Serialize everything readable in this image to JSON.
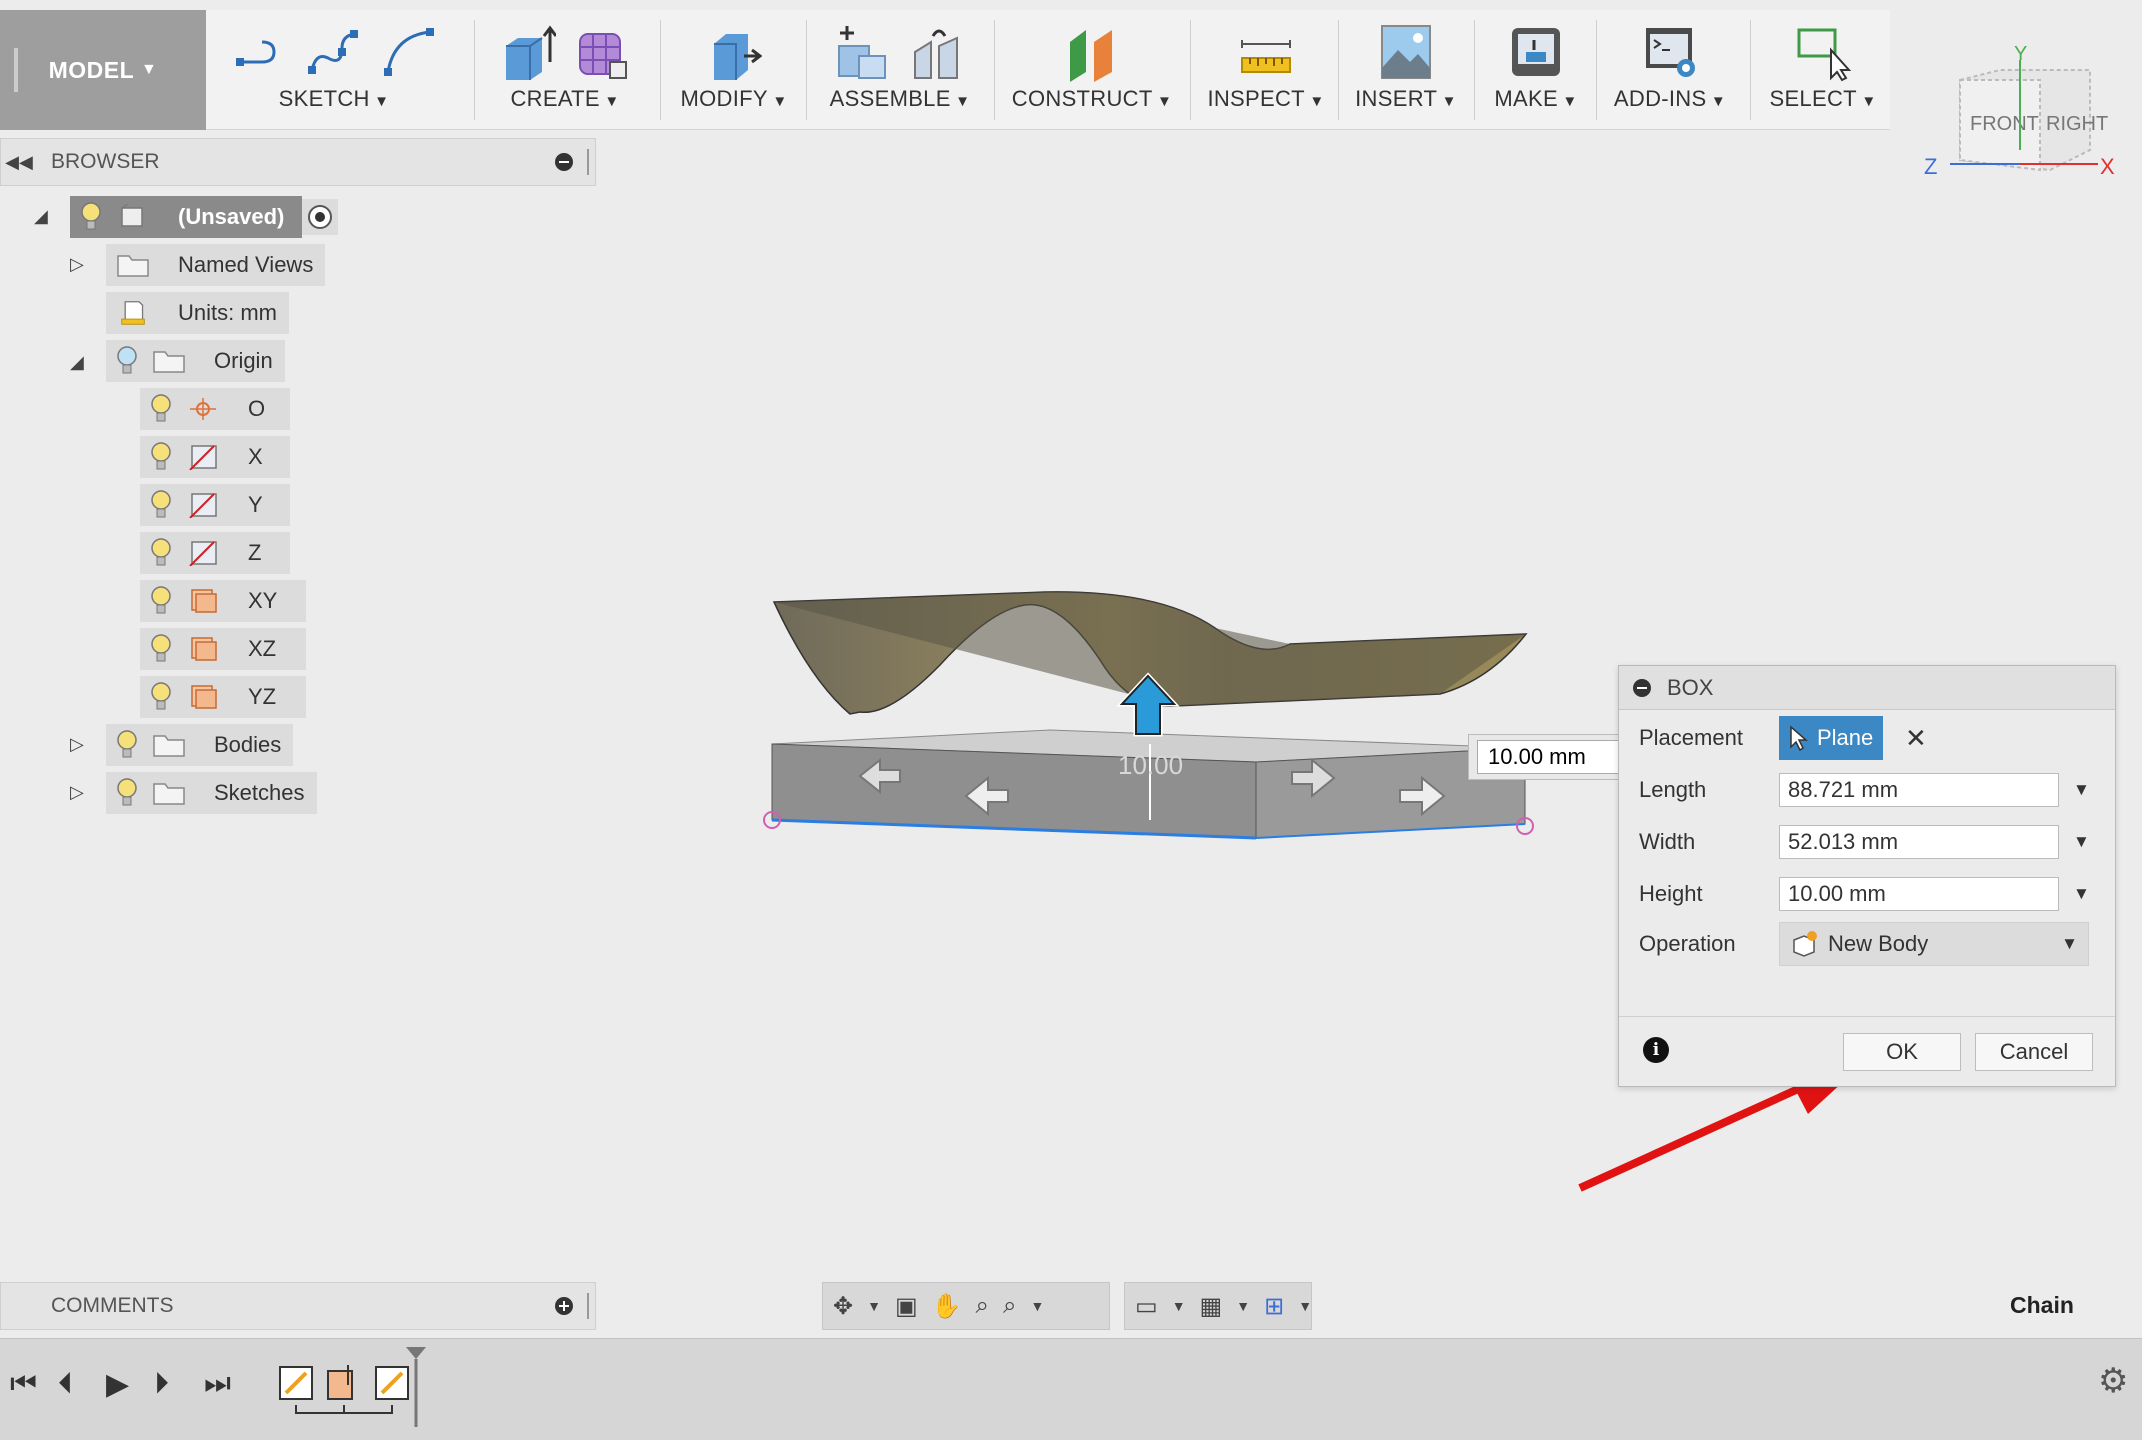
{
  "toolbar": {
    "mode": "MODEL",
    "groups": {
      "sketch": "SKETCH",
      "create": "CREATE",
      "modify": "MODIFY",
      "assemble": "ASSEMBLE",
      "construct": "CONSTRUCT",
      "inspect": "INSPECT",
      "insert": "INSERT",
      "make": "MAKE",
      "addins": "ADD-INS",
      "select": "SELECT"
    }
  },
  "viewcube": {
    "front": "FRONT",
    "right": "RIGHT",
    "x": "X",
    "y": "Y",
    "z": "Z"
  },
  "browser": {
    "title": "BROWSER",
    "root": "(Unsaved)",
    "items": {
      "named_views": "Named Views",
      "units": "Units: mm",
      "origin": "Origin",
      "o": "O",
      "x": "X",
      "y": "Y",
      "z": "Z",
      "xy": "XY",
      "xz": "XZ",
      "yz": "YZ",
      "bodies": "Bodies",
      "sketches": "Sketches"
    }
  },
  "viewport": {
    "dimension_value": "10.00 mm",
    "ghost_label": "10.00"
  },
  "box_dialog": {
    "title": "BOX",
    "placement_label": "Placement",
    "placement_value": "Plane",
    "length_label": "Length",
    "length_value": "88.721 mm",
    "width_label": "Width",
    "width_value": "52.013 mm",
    "height_label": "Height",
    "height_value": "10.00 mm",
    "operation_label": "Operation",
    "operation_value": "New Body",
    "ok": "OK",
    "cancel": "Cancel"
  },
  "comments": {
    "title": "COMMENTS"
  },
  "status": {
    "chain": "Chain"
  },
  "colors": {
    "accent_blue": "#3b88c4",
    "annotation_red": "#e01212",
    "mode_gray": "#9e9e9e"
  }
}
